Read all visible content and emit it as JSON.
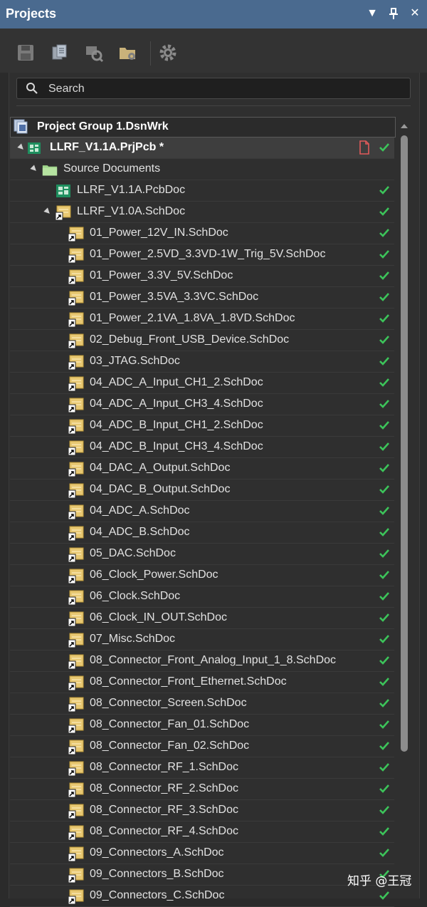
{
  "window": {
    "title": "Projects"
  },
  "toolbar": {
    "buttons": [
      "save-icon",
      "copy-documents-icon",
      "find-component-icon",
      "folder-settings-icon",
      "gear-icon"
    ]
  },
  "search": {
    "placeholder": "Search"
  },
  "tree": {
    "group_label": "Project Group 1.DsnWrk",
    "project_label": "LLRF_V1.1A.PrjPcb *",
    "folder_label": "Source Documents",
    "pcb_label": "LLRF_V1.1A.PcbDoc",
    "top_sch_label": "LLRF_V1.0A.SchDoc",
    "children": [
      "01_Power_12V_IN.SchDoc",
      "01_Power_2.5VD_3.3VD-1W_Trig_5V.SchDoc",
      "01_Power_3.3V_5V.SchDoc",
      "01_Power_3.5VA_3.3VC.SchDoc",
      "01_Power_2.1VA_1.8VA_1.8VD.SchDoc",
      "02_Debug_Front_USB_Device.SchDoc",
      "03_JTAG.SchDoc",
      "04_ADC_A_Input_CH1_2.SchDoc",
      "04_ADC_A_Input_CH3_4.SchDoc",
      "04_ADC_B_Input_CH1_2.SchDoc",
      "04_ADC_B_Input_CH3_4.SchDoc",
      "04_DAC_A_Output.SchDoc",
      "04_DAC_B_Output.SchDoc",
      "04_ADC_A.SchDoc",
      "04_ADC_B.SchDoc",
      "05_DAC.SchDoc",
      "06_Clock_Power.SchDoc",
      "06_Clock.SchDoc",
      "06_Clock_IN_OUT.SchDoc",
      "07_Misc.SchDoc",
      "08_Connector_Front_Analog_Input_1_8.SchDoc",
      "08_Connector_Front_Ethernet.SchDoc",
      "08_Connector_Screen.SchDoc",
      "08_Connector_Fan_01.SchDoc",
      "08_Connector_Fan_02.SchDoc",
      "08_Connector_RF_1.SchDoc",
      "08_Connector_RF_2.SchDoc",
      "08_Connector_RF_3.SchDoc",
      "08_Connector_RF_4.SchDoc",
      "09_Connectors_A.SchDoc",
      "09_Connectors_B.SchDoc",
      "09_Connectors_C.SchDoc"
    ]
  },
  "watermark": "知乎 @王冠",
  "colors": {
    "titlebar": "#4a6a8f",
    "check": "#3cc45a",
    "modified": "#e05a5a"
  }
}
